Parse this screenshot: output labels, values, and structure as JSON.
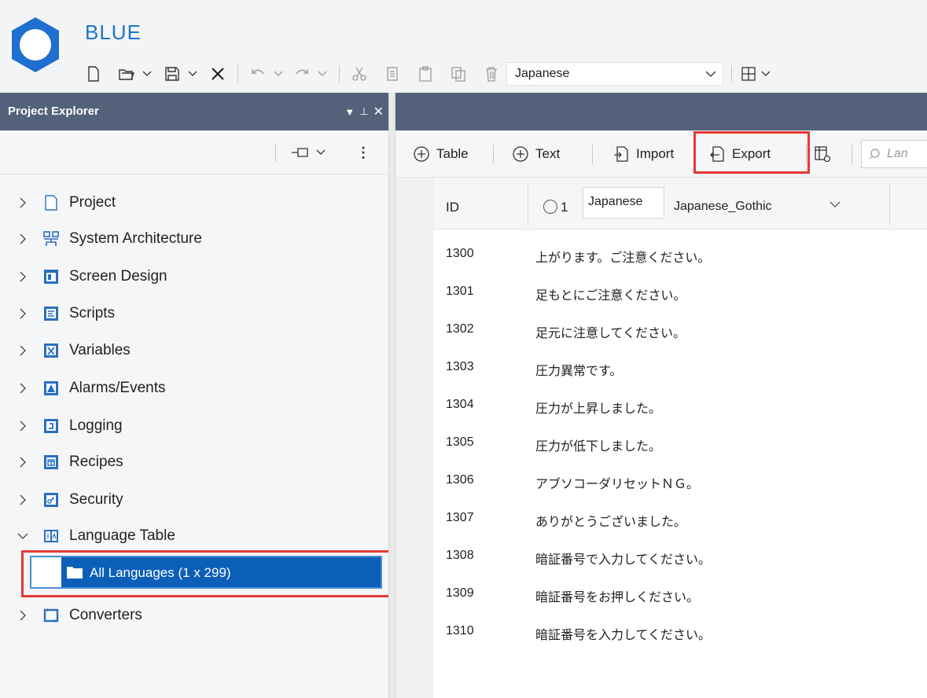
{
  "app": {
    "title": "BLUE"
  },
  "toolbar": {
    "language_select": "Japanese",
    "icons": [
      "new-file-icon",
      "open-folder-icon",
      "save-icon",
      "close-icon",
      "undo-icon",
      "redo-icon",
      "cut-icon",
      "copy-icon",
      "paste-icon",
      "duplicate-icon",
      "delete-icon",
      "layout-icon"
    ]
  },
  "explorer": {
    "title": "Project Explorer",
    "items": [
      {
        "label": "Project",
        "icon": "project-icon"
      },
      {
        "label": "System Architecture",
        "icon": "system-architecture-icon"
      },
      {
        "label": "Screen Design",
        "icon": "screen-design-icon"
      },
      {
        "label": "Scripts",
        "icon": "scripts-icon"
      },
      {
        "label": "Variables",
        "icon": "variables-icon"
      },
      {
        "label": "Alarms/Events",
        "icon": "alarms-icon"
      },
      {
        "label": "Logging",
        "icon": "logging-icon"
      },
      {
        "label": "Recipes",
        "icon": "recipes-icon"
      },
      {
        "label": "Security",
        "icon": "security-icon"
      },
      {
        "label": "Language Table",
        "icon": "language-table-icon"
      },
      {
        "label": "Converters",
        "icon": "converters-icon"
      }
    ],
    "selected_child": "All Languages (1 x 299)"
  },
  "main_toolbar": {
    "table_label": "Table",
    "text_label": "Text",
    "import_label": "Import",
    "export_label": "Export",
    "search_placeholder": "Lan"
  },
  "grid": {
    "id_header": "ID",
    "col_number": "1",
    "col_language": "Japanese",
    "col_font": "Japanese_Gothic",
    "rows": [
      {
        "id": "1300",
        "text": "上がります。ご注意ください。"
      },
      {
        "id": "1301",
        "text": "足もとにご注意ください。"
      },
      {
        "id": "1302",
        "text": "足元に注意してください。"
      },
      {
        "id": "1303",
        "text": "圧力異常です。"
      },
      {
        "id": "1304",
        "text": "圧力が上昇しました。"
      },
      {
        "id": "1305",
        "text": "圧力が低下しました。"
      },
      {
        "id": "1306",
        "text": "アブソコーダリセットＮＧ。"
      },
      {
        "id": "1307",
        "text": "ありがとうございました。"
      },
      {
        "id": "1308",
        "text": "暗証番号で入力してください。"
      },
      {
        "id": "1309",
        "text": "暗証番号をお押しください。"
      },
      {
        "id": "1310",
        "text": "暗証番号を入力してください。"
      }
    ]
  }
}
